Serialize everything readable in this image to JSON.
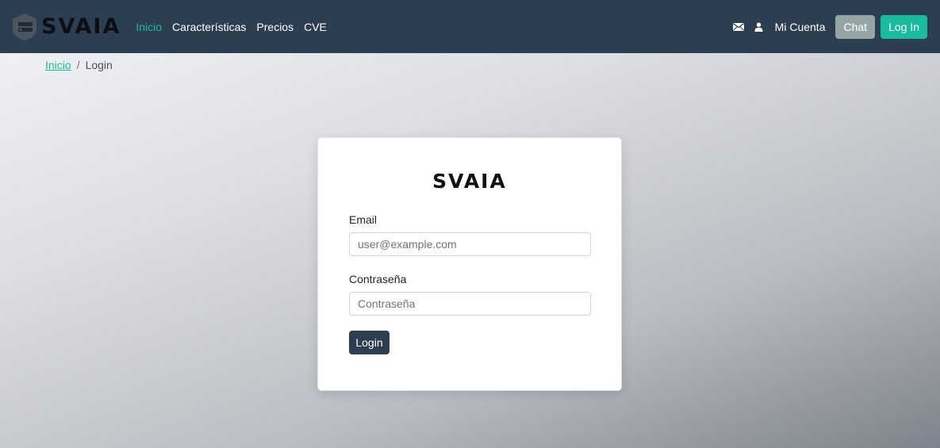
{
  "navbar": {
    "brand": "SVAIA",
    "links": [
      {
        "label": "Inicio",
        "active": true
      },
      {
        "label": "Características",
        "active": false
      },
      {
        "label": "Precios",
        "active": false
      },
      {
        "label": "CVE",
        "active": false
      }
    ],
    "icons": [
      "envelope-icon",
      "user-icon"
    ],
    "account_label": "Mi Cuenta",
    "chat_label": "Chat",
    "login_label": "Log In"
  },
  "breadcrumb": {
    "home": "Inicio",
    "separator": "/",
    "current": "Login"
  },
  "login_form": {
    "title": "SVAIA",
    "email_label": "Email",
    "email_placeholder": "user@example.com",
    "password_label": "Contraseña",
    "password_placeholder": "Contraseña",
    "submit_label": "Login"
  },
  "colors": {
    "navbar": "#2c3e50",
    "accent": "#18bc9c",
    "chat_button": "#95a5a6",
    "submit_button": "#2c3e50"
  }
}
